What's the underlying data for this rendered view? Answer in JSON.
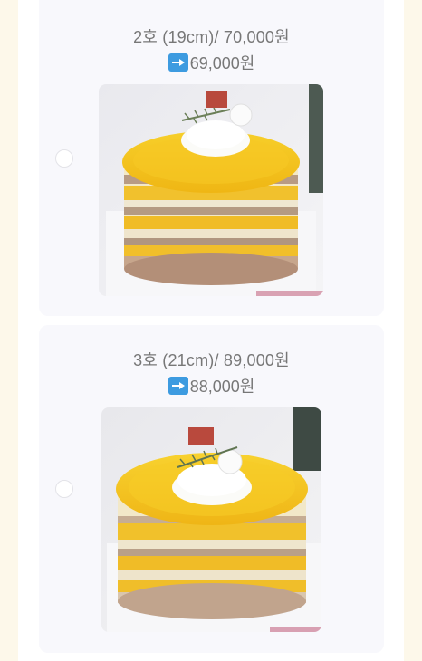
{
  "options": [
    {
      "size_label": "2호 (19cm)/ 70,000원",
      "sale_price": "69,000원",
      "image_alt": "mango cake 19cm"
    },
    {
      "size_label": "3호 (21cm)/ 89,000원",
      "sale_price": "88,000원",
      "image_alt": "mango cake 21cm"
    }
  ],
  "icons": {
    "arrow": "right-arrow-emoji-icon",
    "radio": "radio-button"
  },
  "colors": {
    "page_background": "#fdf8ea",
    "card_background": "#f8f8fc",
    "arrow_blue": "#3d9be0",
    "text_gray": "#777777"
  }
}
